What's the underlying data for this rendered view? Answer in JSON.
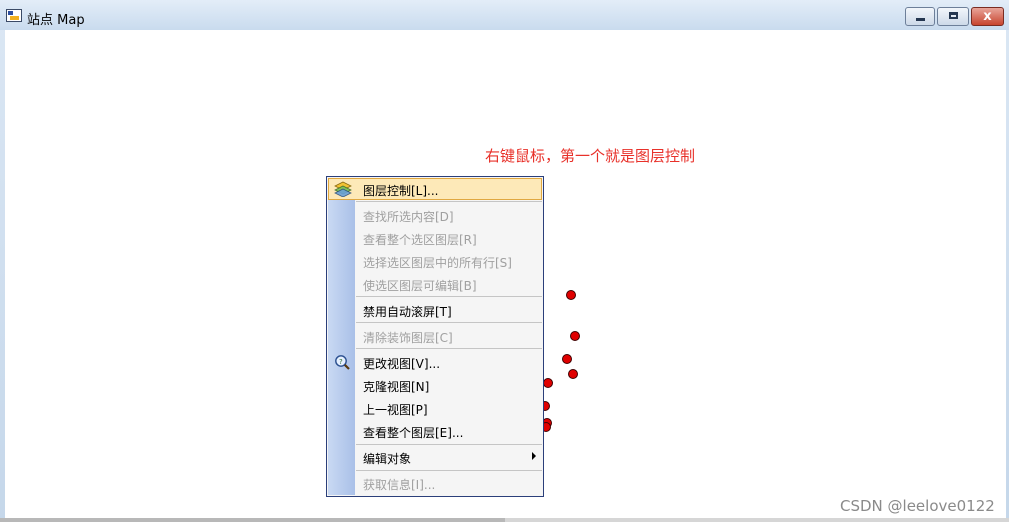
{
  "window": {
    "title": "站点 Map",
    "close_glyph": "x"
  },
  "annotation": "右键鼠标，第一个就是图层控制",
  "context_menu": {
    "items": [
      {
        "label": "图层控制[L]...",
        "enabled": true,
        "highlighted": true,
        "icon": "layers-icon"
      },
      {
        "label": "查找所选内容[D]",
        "enabled": false
      },
      {
        "label": "查看整个选区图层[R]",
        "enabled": false
      },
      {
        "label": "选择选区图层中的所有行[S]",
        "enabled": false
      },
      {
        "label": "使选区图层可编辑[B]",
        "enabled": false
      },
      {
        "label": "禁用自动滚屏[T]",
        "enabled": true
      },
      {
        "label": "清除装饰图层[C]",
        "enabled": false
      },
      {
        "label": "更改视图[V]...",
        "enabled": true,
        "icon": "magnifier-icon"
      },
      {
        "label": "克隆视图[N]",
        "enabled": true
      },
      {
        "label": "上一视图[P]",
        "enabled": true
      },
      {
        "label": "查看整个图层[E]...",
        "enabled": true
      },
      {
        "label": "编辑对象",
        "enabled": true,
        "submenu": true
      },
      {
        "label": "获取信息[I]...",
        "enabled": false
      }
    ]
  },
  "map": {
    "point_color": "#e00000",
    "visible_points": 8
  },
  "watermark": "CSDN @leelove0122"
}
